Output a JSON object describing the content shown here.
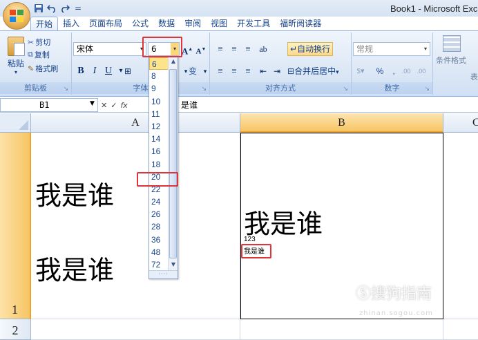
{
  "window": {
    "title": "Book1 - Microsoft Exce"
  },
  "quick_access": {
    "undo_icon": "undo-icon",
    "redo_icon": "redo-icon",
    "separator": "="
  },
  "tabs": [
    {
      "label": "开始",
      "active": true
    },
    {
      "label": "插入"
    },
    {
      "label": "页面布局"
    },
    {
      "label": "公式"
    },
    {
      "label": "数据"
    },
    {
      "label": "审阅"
    },
    {
      "label": "视图"
    },
    {
      "label": "开发工具"
    },
    {
      "label": "福昕阅读器"
    }
  ],
  "ribbon": {
    "clipboard": {
      "paste": "粘贴",
      "cut": "剪切",
      "copy": "复制",
      "format_painter": "格式刷",
      "group_label": "剪贴板"
    },
    "font": {
      "font_name": "宋体",
      "font_size": "6",
      "bold": "B",
      "italic": "I",
      "underline": "U",
      "phonetic": "变",
      "group_label": "字体"
    },
    "alignment": {
      "wrap_text": "自动换行",
      "merge_center": "合并后居中",
      "group_label": "对齐方式"
    },
    "number": {
      "format": "常规",
      "percent": "%",
      "comma": ",",
      "inc_decimal": ".00",
      "dec_decimal": ".00",
      "group_label": "数字"
    },
    "styles": {
      "conditional_format": "条件格式",
      "table_cut": "表"
    }
  },
  "formula_bar": {
    "cell_ref": "B1",
    "fx": "fx",
    "content": "谁",
    "content_prefix": "是"
  },
  "size_list": {
    "sizes": [
      "6",
      "8",
      "9",
      "10",
      "11",
      "12",
      "14",
      "16",
      "18",
      "20",
      "22",
      "24",
      "26",
      "28",
      "36",
      "48",
      "72"
    ],
    "selected": "6",
    "hover": "20"
  },
  "sheet": {
    "columns": [
      "A",
      "B",
      "C"
    ],
    "rows": [
      "1",
      "2"
    ],
    "cells": {
      "A1_line1": "我是谁",
      "A1_line2": "我是谁",
      "B1_large": "我是谁",
      "B1_number": "123",
      "B1_small": "我是谁"
    }
  },
  "watermark": {
    "text": "搜狗指南",
    "sub": "zhinan.sogou.com"
  }
}
